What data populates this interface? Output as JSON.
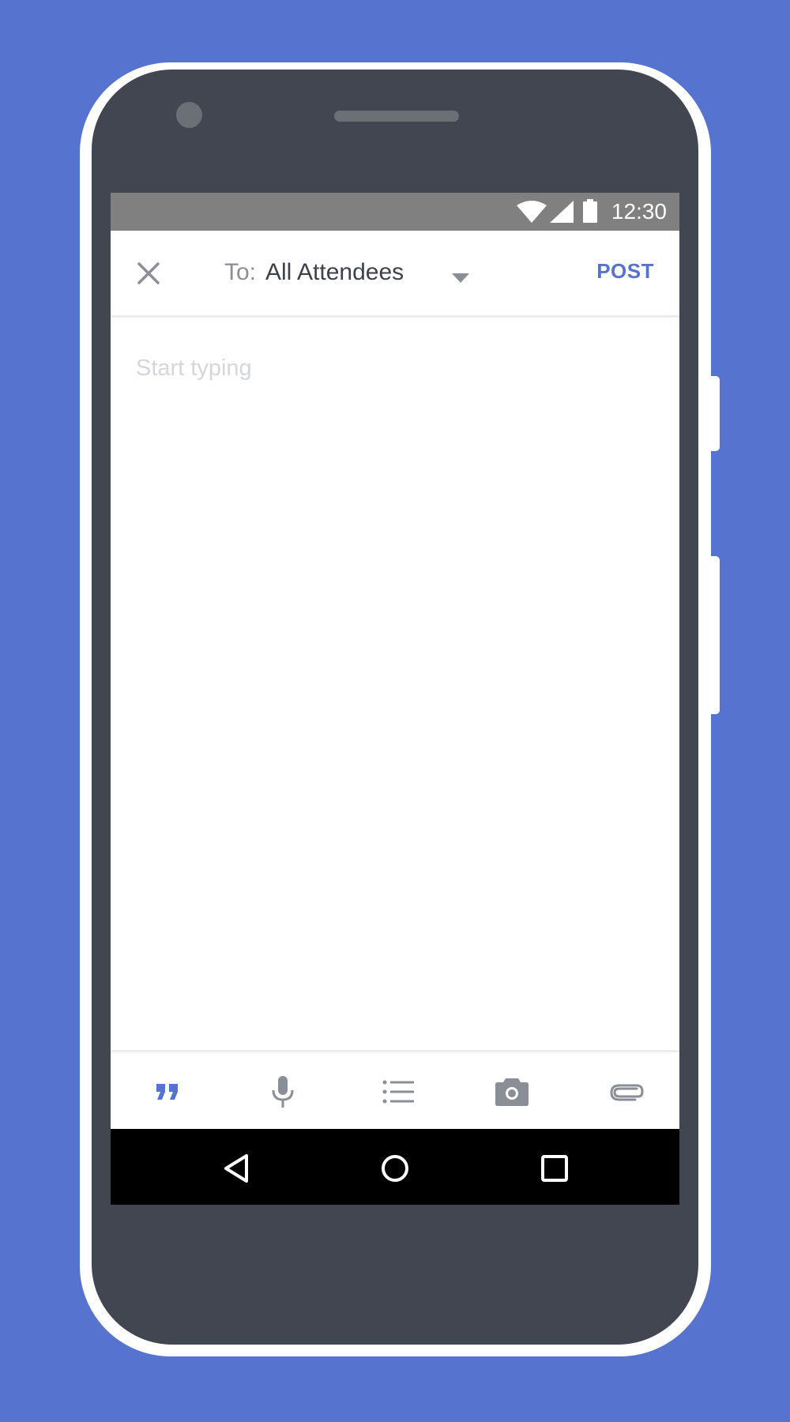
{
  "status_bar": {
    "time": "12:30"
  },
  "compose": {
    "to_label": "To:",
    "recipient": "All Attendees",
    "post_label": "POST",
    "placeholder": "Start typing"
  },
  "toolbar": {
    "items": [
      "quote-icon",
      "microphone-icon",
      "list-icon",
      "camera-icon",
      "attachment-icon"
    ],
    "active_item": "quote-icon"
  },
  "nav_bar": {
    "items": [
      "back-icon",
      "home-icon",
      "recents-icon"
    ]
  },
  "colors": {
    "background": "#5673cf",
    "accent": "#5673cf",
    "phone_body": "#424651",
    "icon_gray": "#8a8e97"
  }
}
